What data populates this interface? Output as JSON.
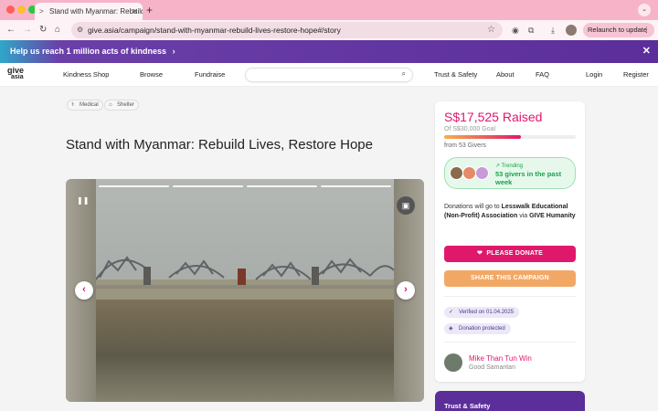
{
  "browser": {
    "tab_title": "Stand with Myanmar: Rebuild",
    "new_tab": "+",
    "url": "give.asia/campaign/stand-with-myanmar-rebuild-lives-restore-hope#/story",
    "relaunch_label": "Relaunch to update",
    "colors": {
      "chrome": "#f7b4c8",
      "toolbar": "#fdf3f6"
    }
  },
  "promo": {
    "text": "Help us reach 1 million acts of kindness",
    "chevron": "›",
    "close": "✕"
  },
  "nav": {
    "logo_top": "give",
    "logo_bottom": "asia",
    "links": [
      "Kindness Shop",
      "Browse",
      "Fundraise",
      "Trust & Safety",
      "About",
      "FAQ",
      "Login",
      "Register"
    ],
    "search_placeholder": ""
  },
  "tags": [
    "Medical",
    "Shelter"
  ],
  "campaign": {
    "title": "Stand with Myanmar: Rebuild Lives, Restore Hope"
  },
  "media": {
    "slides_count": 4,
    "active_slide": 1
  },
  "donate": {
    "raised": "S$17,525 Raised",
    "goal": "Of S$30,000 Goal",
    "progress": 0.584,
    "givers": "from 53 Givers",
    "trending_label": "Trending",
    "trending_text": "53 givers in the past week",
    "desc_prefix": "Donations will go to",
    "recipient": "Lesswalk Educational (Non-Profit) Association",
    "desc_via": "via",
    "via_org": "GIVE Humanity",
    "donate_button": "PLEASE DONATE",
    "share_button": "SHARE THIS CAMPAIGN",
    "verified": "Verified on 01.04.2025",
    "protected": "Donation protected",
    "organizer_name": "Mike Than Tun Win",
    "organizer_role": "Good Samaritan",
    "colors": {
      "accent": "#e0186c",
      "share": "#f2a865",
      "trend_bg": "#e6f8ec",
      "trend_text": "#19a34a"
    }
  },
  "trust_card": {
    "title": "Trust & Safety"
  }
}
